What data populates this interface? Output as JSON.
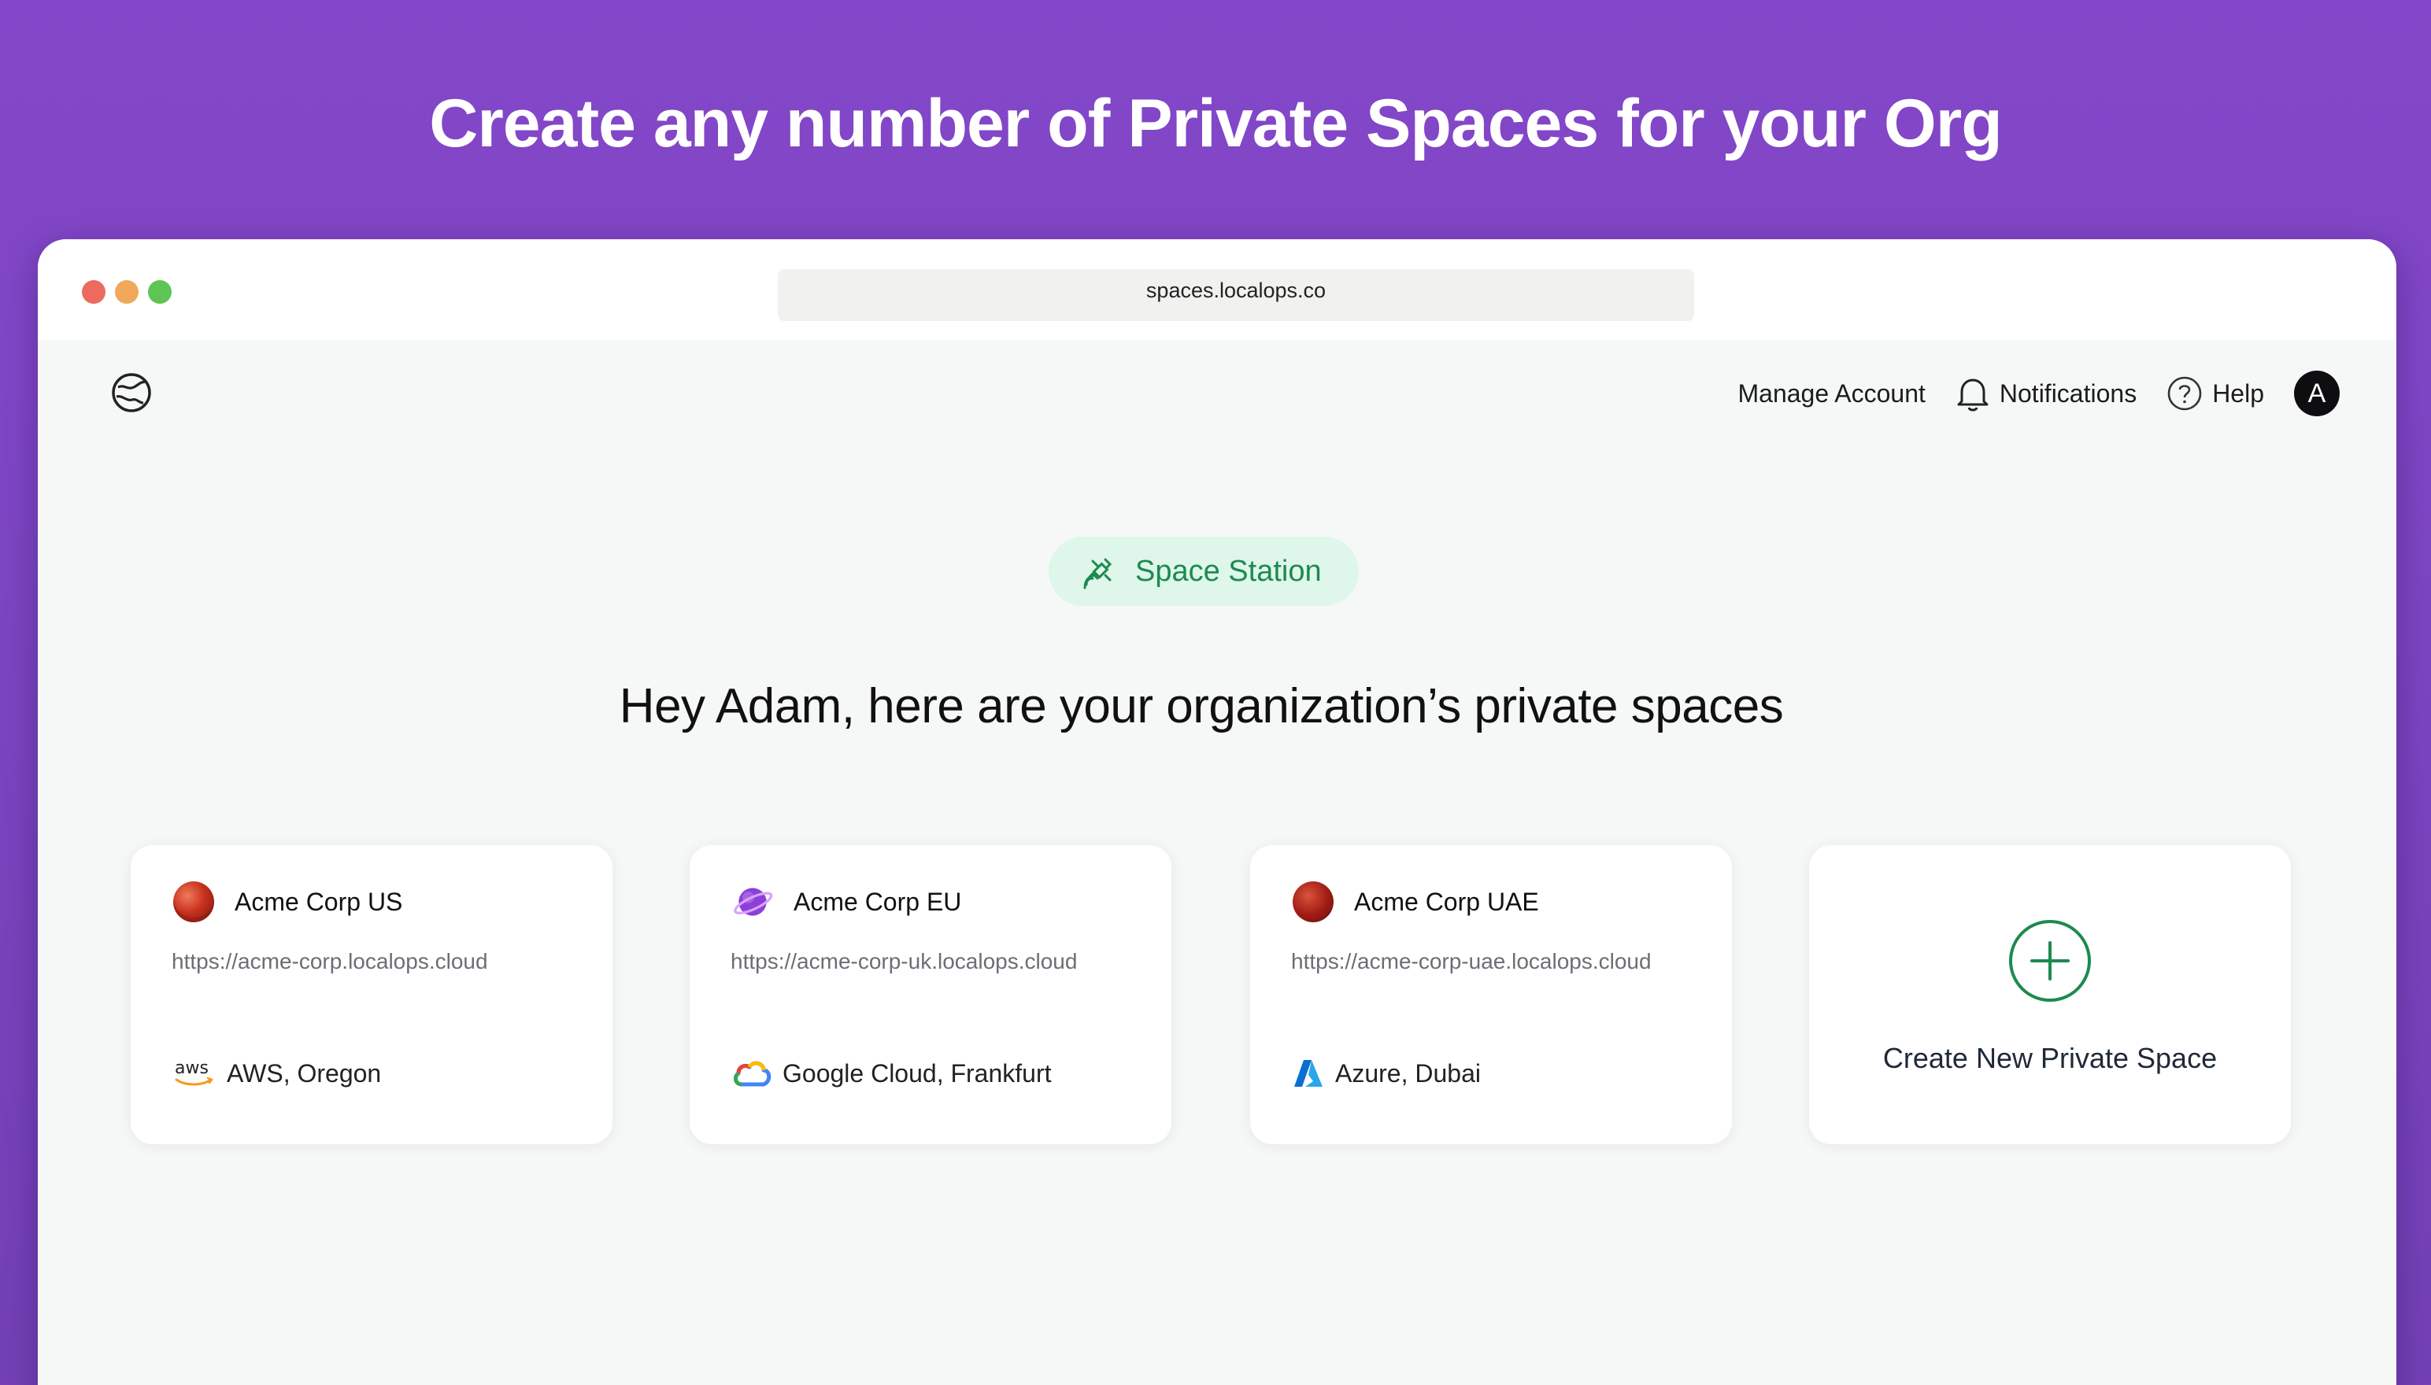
{
  "headline": "Create any number of Private Spaces for your Org",
  "browser": {
    "url": "spaces.localops.co"
  },
  "nav": {
    "manage_account": "Manage Account",
    "notifications": "Notifications",
    "help": "Help",
    "avatar_initial": "A"
  },
  "badge": {
    "label": "Space Station"
  },
  "greeting": "Hey Adam, here are your organization’s private spaces",
  "spaces": [
    {
      "name": "Acme Corp US",
      "url": "https://acme-corp.localops.cloud",
      "provider": "AWS, Oregon",
      "provider_icon": "aws-icon",
      "planet_icon": "red-planet-icon"
    },
    {
      "name": "Acme Corp EU",
      "url": "https://acme-corp-uk.localops.cloud",
      "provider": "Google Cloud, Frankfurt",
      "provider_icon": "google-cloud-icon",
      "planet_icon": "ringed-planet-icon"
    },
    {
      "name": "Acme Corp UAE",
      "url": "https://acme-corp-uae.localops.cloud",
      "provider": "Azure, Dubai",
      "provider_icon": "azure-icon",
      "planet_icon": "mars-icon"
    }
  ],
  "create_card": {
    "label": "Create New Private Space"
  },
  "colors": {
    "background": "#8447c9",
    "badge_bg": "#dff6ea",
    "accent_green": "#1d8a4f"
  }
}
